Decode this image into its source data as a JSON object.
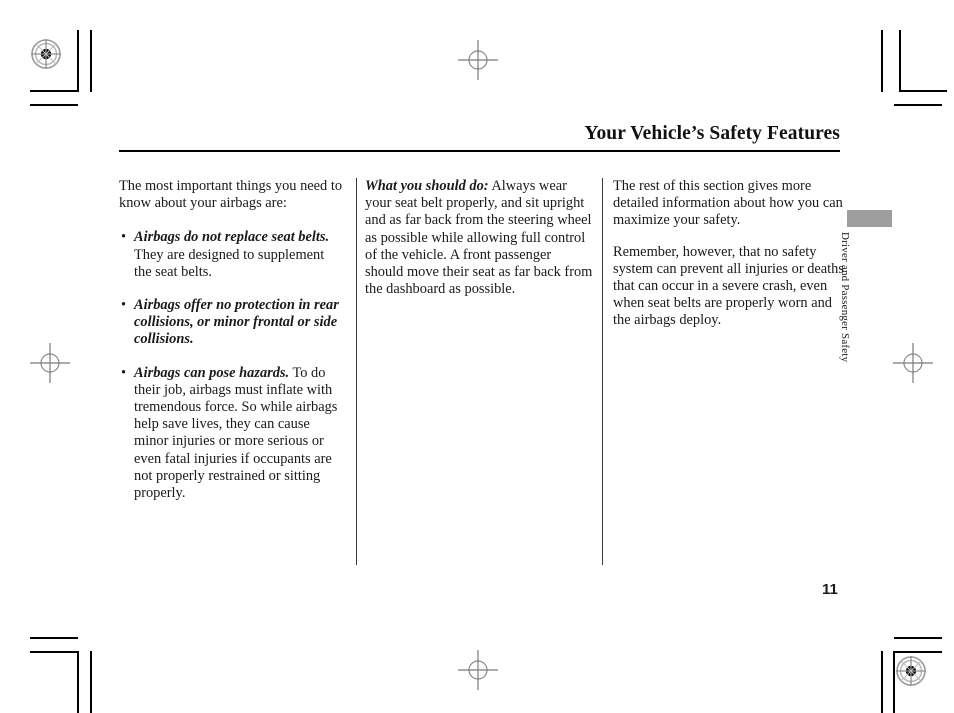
{
  "page": {
    "title": "Your Vehicle’s Safety Features",
    "number": "11",
    "side_tab_label": "Driver and Passenger Safety",
    "side_tab_color": "#9e9e9e"
  },
  "column_1": {
    "intro": "The most important things you need to know about your airbags are:",
    "bullet_marker": "•",
    "bullets": [
      {
        "lead": "Airbags do not replace seat belts.",
        "body": " They are designed to supplement the seat belts."
      },
      {
        "lead": "Airbags offer no protection in rear collisions, or minor frontal or side collisions.",
        "body": ""
      },
      {
        "lead": "Airbags can pose hazards.",
        "body": " To do their job, airbags must inflate with tremendous force. So while airbags help save lives, they can cause minor injuries or more serious or even fatal injuries if occupants are not properly restrained or sitting properly."
      }
    ]
  },
  "column_2": {
    "lead": "What you should do:",
    "body": " Always wear your seat belt properly, and sit upright and as far back from the steering wheel as possible while allowing full control of the vehicle. A front passenger should move their seat as far back from the dashboard as possible."
  },
  "column_3": {
    "paragraph_1": "The rest of this section gives more detailed information about how you can maximize your safety.",
    "paragraph_2": "Remember, however, that no safety system can prevent all injuries or deaths that can occur in a severe crash, even when seat belts are properly worn and the airbags deploy."
  },
  "print_marks": {
    "rosette_name": "registration-rosette",
    "crosshair_name": "registration-crosshair",
    "crop_mark_name": "crop-mark"
  }
}
